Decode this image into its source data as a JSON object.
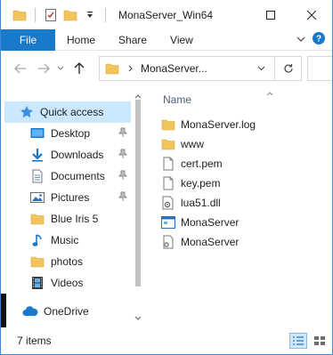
{
  "window": {
    "title": "MonaServer_Win64"
  },
  "ribbon": {
    "tabs": [
      "File",
      "Home",
      "Share",
      "View"
    ]
  },
  "address": {
    "path": "MonaServer..."
  },
  "nav": {
    "quick_access": "Quick access",
    "items": [
      {
        "label": "Desktop",
        "icon": "desktop-icon",
        "pinned": true
      },
      {
        "label": "Downloads",
        "icon": "downloads-icon",
        "pinned": true
      },
      {
        "label": "Documents",
        "icon": "documents-icon",
        "pinned": true
      },
      {
        "label": "Pictures",
        "icon": "pictures-icon",
        "pinned": true
      },
      {
        "label": "Blue Iris 5",
        "icon": "folder-icon",
        "pinned": false
      },
      {
        "label": "Music",
        "icon": "music-icon",
        "pinned": false
      },
      {
        "label": "photos",
        "icon": "folder-icon",
        "pinned": false
      },
      {
        "label": "Videos",
        "icon": "videos-icon",
        "pinned": false
      }
    ],
    "onedrive": "OneDrive"
  },
  "content": {
    "column_name": "Name",
    "files": [
      {
        "name": "MonaServer.log",
        "icon": "folder-icon"
      },
      {
        "name": "www",
        "icon": "folder-icon"
      },
      {
        "name": "cert.pem",
        "icon": "file-icon"
      },
      {
        "name": "key.pem",
        "icon": "file-icon"
      },
      {
        "name": "lua51.dll",
        "icon": "dll-icon"
      },
      {
        "name": "MonaServer",
        "icon": "application-icon"
      },
      {
        "name": "MonaServer",
        "icon": "config-icon"
      }
    ]
  },
  "status": {
    "item_count": "7 items"
  },
  "colors": {
    "accent": "#1979ca",
    "selected": "#cce8ff",
    "folder": "#f2c55c"
  }
}
